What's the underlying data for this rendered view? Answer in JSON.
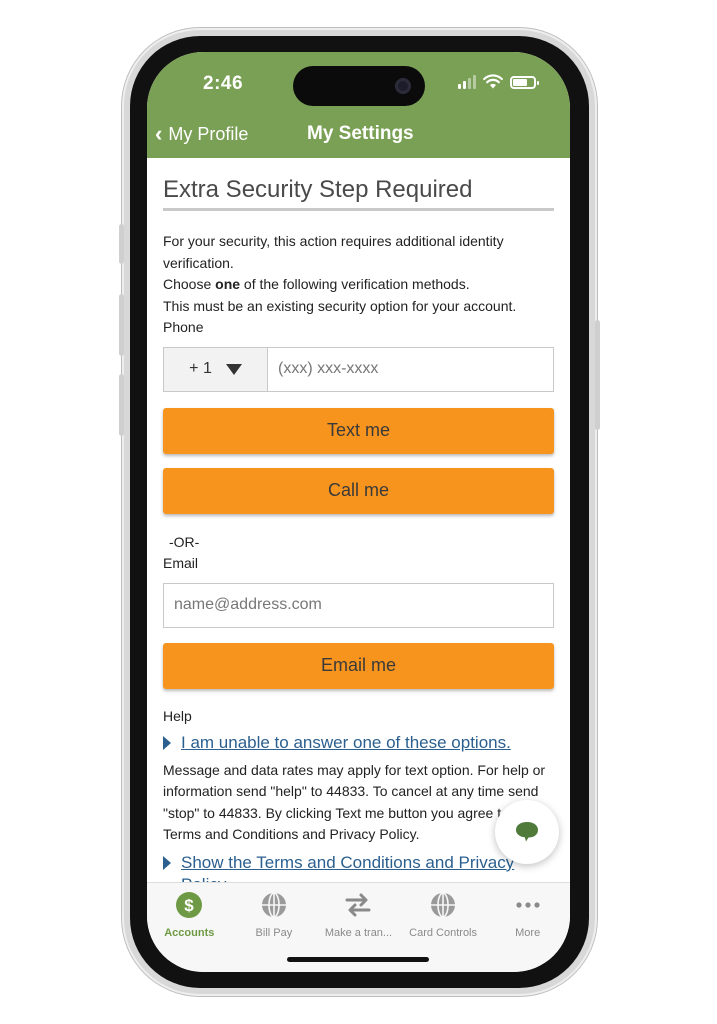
{
  "status_bar": {
    "time": "2:46"
  },
  "nav": {
    "back_label": "My Profile",
    "title": "My Settings"
  },
  "page": {
    "title": "Extra Security Step Required",
    "intro": "For your security, this action requires additional identity verification.",
    "choose_prefix": "Choose ",
    "choose_bold": "one",
    "choose_suffix": " of the following verification methods.",
    "existing_note": "This must be an existing security option for your account.",
    "phone_label": "Phone",
    "country_code": "+ 1",
    "phone_placeholder": "(xxx) xxx-xxxx",
    "text_button": "Text me",
    "call_button": "Call me",
    "or_label": "-OR-",
    "email_label": "Email",
    "email_placeholder": "name@address.com",
    "email_button": "Email me",
    "help_label": "Help",
    "unable_link": "I am unable to answer one of these options.",
    "disclaimer": "Message and data rates may apply for text option. For help or information send \"help\" to 44833. To cancel at any time send \"stop\" to 44833. By clicking Text me button you agree to the Terms and Conditions and Privacy Policy.",
    "terms_link": "Show the Terms and Conditions and Privacy Policy"
  },
  "tabs": [
    {
      "label": "Accounts",
      "icon": "dollar-circle-icon",
      "active": true
    },
    {
      "label": "Bill Pay",
      "icon": "globe-icon",
      "active": false
    },
    {
      "label": "Make a tran...",
      "icon": "transfer-arrows-icon",
      "active": false
    },
    {
      "label": "Card Controls",
      "icon": "globe-icon",
      "active": false
    },
    {
      "label": "More",
      "icon": "more-dots-icon",
      "active": false
    }
  ],
  "colors": {
    "header_green": "#7aa055",
    "button_orange": "#f7941d",
    "link_blue": "#2a5f8f",
    "active_tab": "#6f9a45",
    "chat_green": "#4f7a3a"
  }
}
